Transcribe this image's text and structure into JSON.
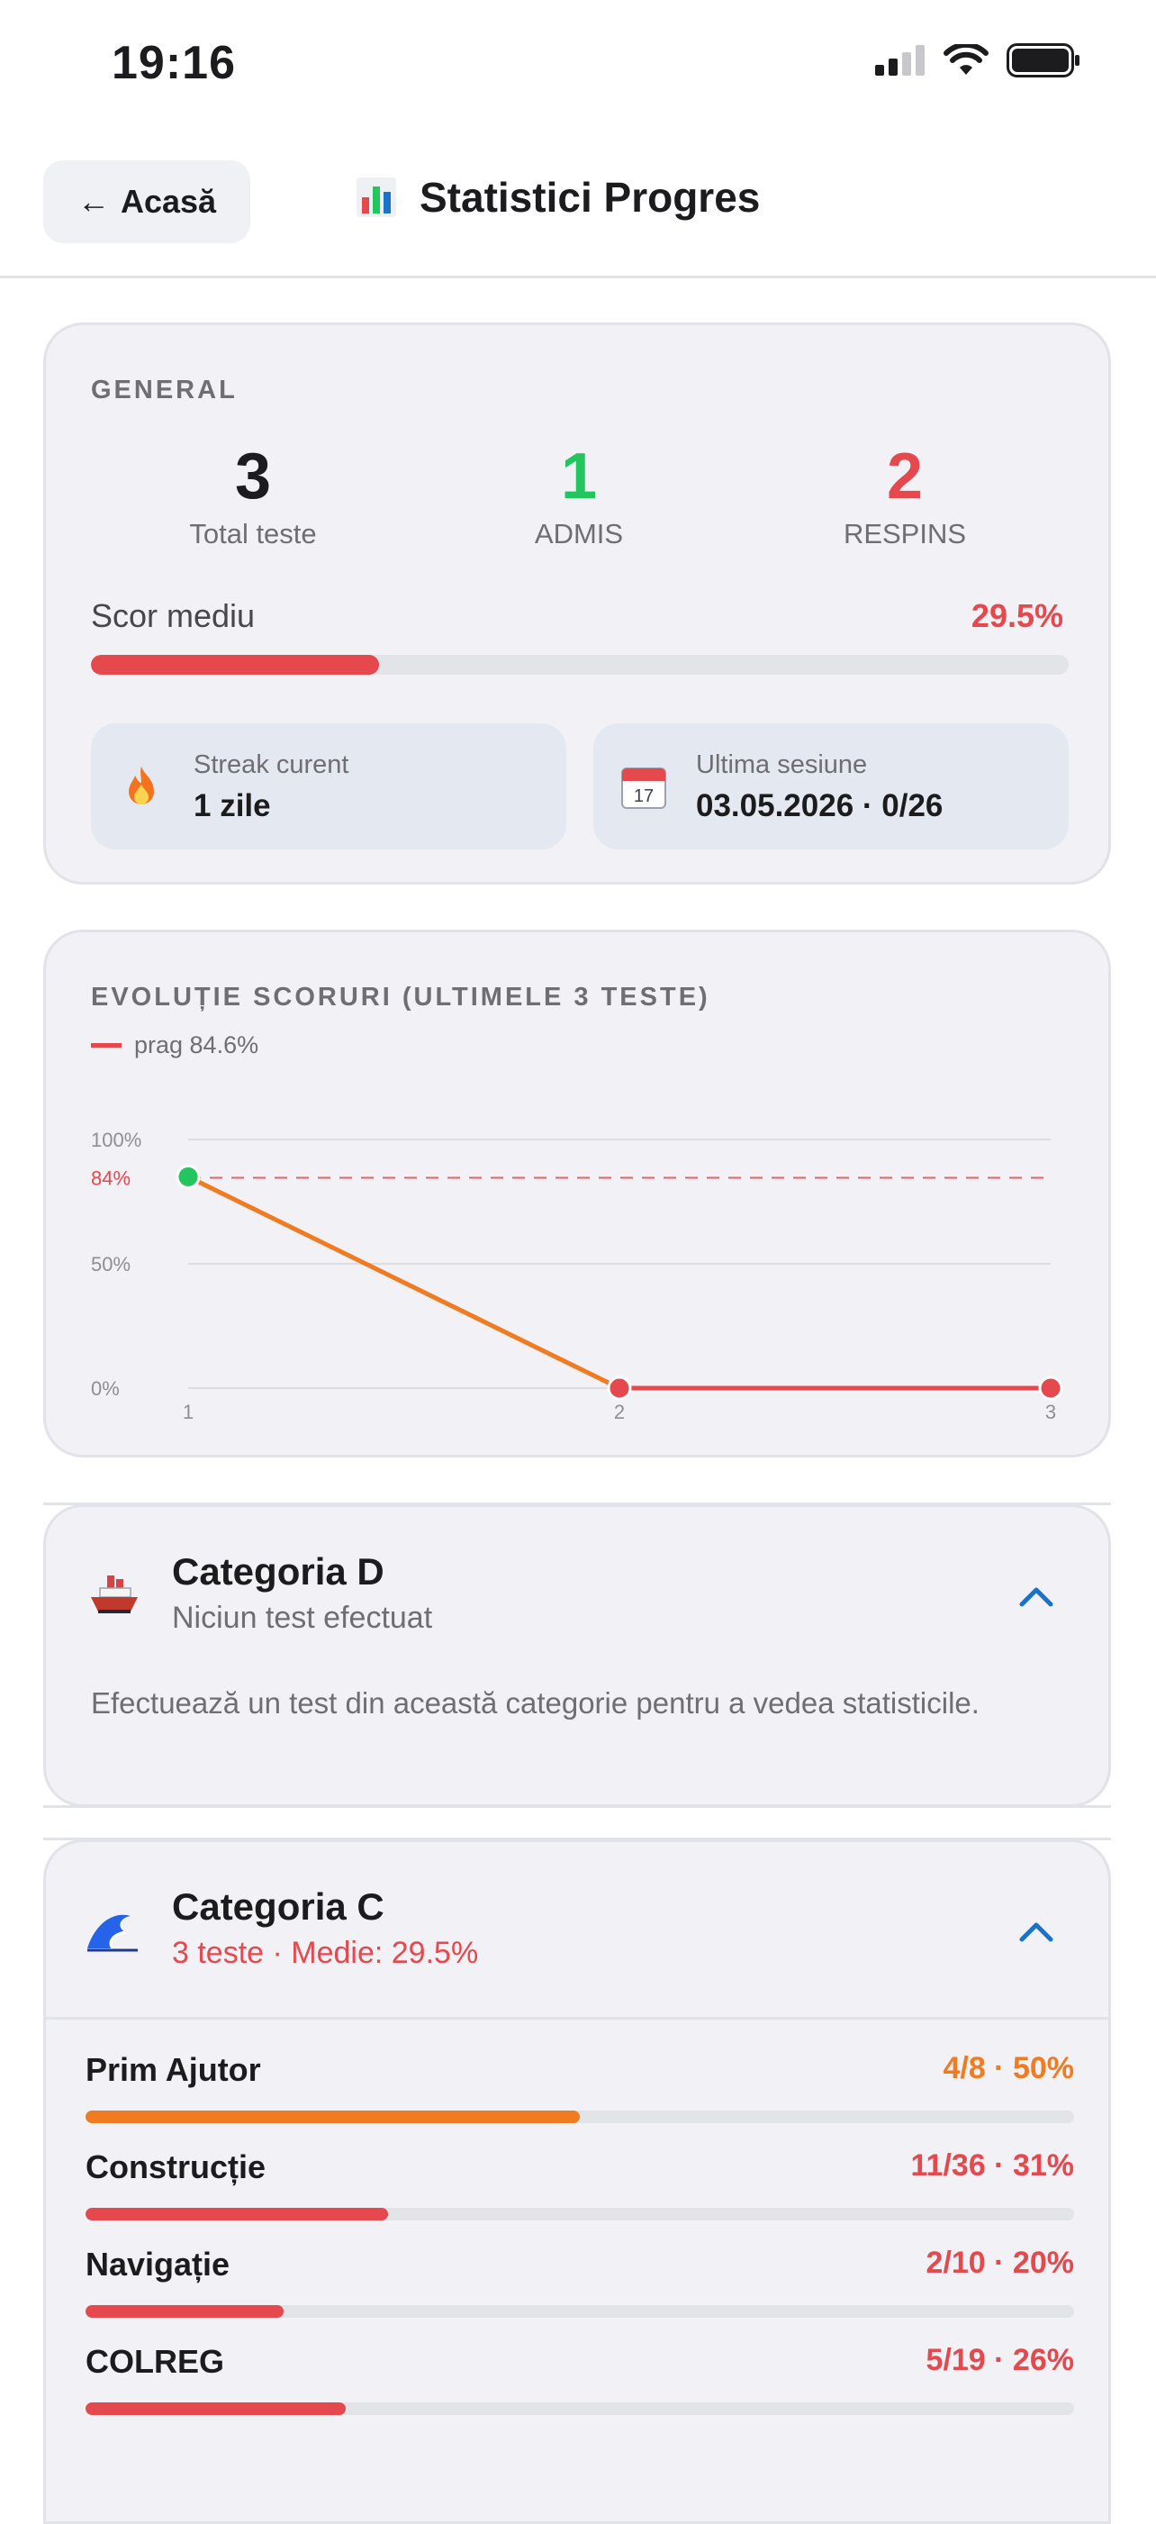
{
  "status": {
    "time": "19:16"
  },
  "header": {
    "back_label": "Acasă",
    "title": "Statistici Progres"
  },
  "general": {
    "section_title": "GENERAL",
    "total_value": "3",
    "total_label": "Total teste",
    "admis_value": "1",
    "admis_label": "ADMIS",
    "respins_value": "2",
    "respins_label": "RESPINS",
    "score_label": "Scor mediu",
    "score_value": "29.5%",
    "score_fraction": 0.295,
    "streak_label": "Streak curent",
    "streak_value": "1 zile",
    "last_label": "Ultima sesiune",
    "last_value": "03.05.2026 · 0/26"
  },
  "chart_data": {
    "type": "line",
    "title": "EVOLUȚIE SCORURI (ULTIMELE 3 TESTE)",
    "legend": "prag 84.6%",
    "threshold": 84.6,
    "threshold_tick": "84%",
    "x": [
      1,
      2,
      3
    ],
    "x_ticks": [
      "1",
      "2",
      "3"
    ],
    "y_ticks": [
      "100%",
      "50%",
      "0%"
    ],
    "ylim": [
      0,
      100
    ],
    "values": [
      85,
      0,
      0
    ],
    "colors": {
      "line_down": "#f07b21",
      "line_flat": "#e5484d",
      "pass": "#22c55e",
      "fail": "#e5484d",
      "threshold": "#e5484d"
    }
  },
  "categories": [
    {
      "icon": "ship-icon",
      "title": "Categoria D",
      "subtitle": "Niciun test efectuat",
      "note": "Efectuează un test din această categorie pentru a vedea statisticile."
    },
    {
      "icon": "wave-icon",
      "title": "Categoria C",
      "subtitle": "3 teste · Medie: 29.5%",
      "subjects": [
        {
          "name": "Prim Ajutor",
          "score": "4/8 · 50%",
          "fraction": 0.5,
          "color": "#f07b21"
        },
        {
          "name": "Construcție",
          "score": "11/36 · 31%",
          "fraction": 0.306,
          "color": "#e5484d"
        },
        {
          "name": "Navigație",
          "score": "2/10 · 20%",
          "fraction": 0.2,
          "color": "#e5484d"
        },
        {
          "name": "COLREG",
          "score": "5/19 · 26%",
          "fraction": 0.263,
          "color": "#e5484d"
        }
      ]
    }
  ],
  "colors": {
    "accent_blue": "#1a73c8",
    "pass": "#22c55e",
    "fail": "#e5484d",
    "warn": "#f07b21"
  }
}
